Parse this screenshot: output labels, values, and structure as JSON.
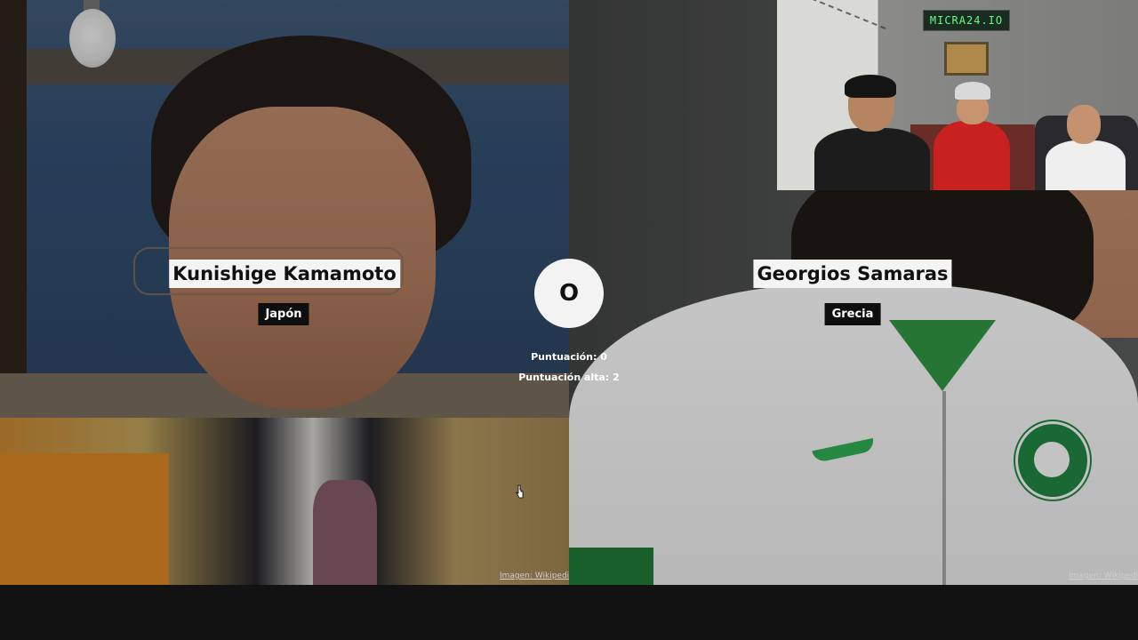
{
  "left": {
    "name": "Kunishige Kamamoto",
    "country": "Japón",
    "credit": "Imagen: Wikipedia"
  },
  "right": {
    "name": "Georgios Samaras",
    "country": "Grecia",
    "credit": "Imagen: Wikipedia"
  },
  "center": {
    "or_label": "O",
    "score": "Puntuación: 0",
    "high_score": "Puntuación alta: 2"
  },
  "webcam": {
    "led_text": "MICRA24.IO"
  },
  "colors": {
    "label_bg": "#f4f4f4",
    "country_bg": "#0e0e0e",
    "bottom_bar": "#121212"
  }
}
